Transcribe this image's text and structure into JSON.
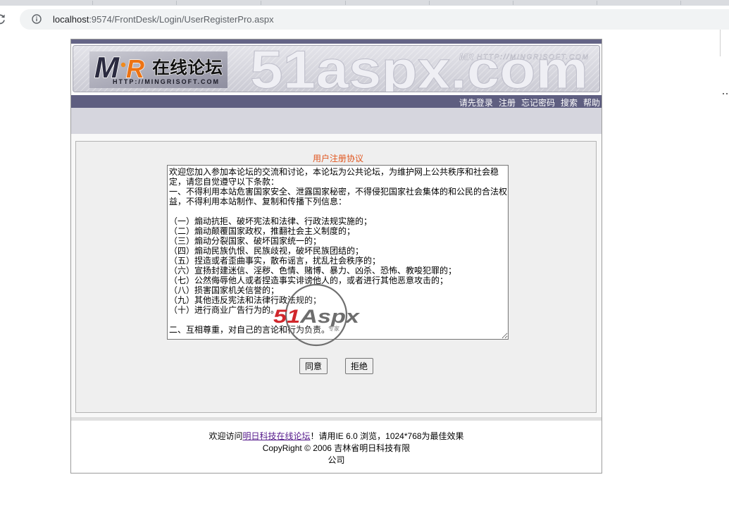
{
  "browser": {
    "url_host": "localhost",
    "url_rest": ":9574/FrontDesk/Login/UserRegisterPro.aspx",
    "icons": {
      "reload": "reload-icon",
      "site_info": "info-icon"
    }
  },
  "banner": {
    "logo_m": "M",
    "logo_r": "R",
    "logo_name": "在线论坛",
    "logo_url": "HTTP://MINGRISOFT.COM",
    "watermark_text": "51aspx.com",
    "corner_mark": "MR",
    "corner_url": "HTTP://MINGRISOFT.COM"
  },
  "nav": {
    "items": [
      {
        "label": "请先登录"
      },
      {
        "label": "注册"
      },
      {
        "label": "忘记密码"
      },
      {
        "label": "搜索"
      },
      {
        "label": "帮助"
      }
    ]
  },
  "agreement": {
    "title": "用户注册协议",
    "text": "欢迎您加入参加本论坛的交流和讨论，本论坛为公共论坛，为维护网上公共秩序和社会稳定，请您自觉遵守以下条款：\n一、不得利用本站危害国家安全、泄露国家秘密，不得侵犯国家社会集体的和公民的合法权益，不得利用本站制作、复制和传播下列信息：\n\n（一）煽动抗拒、破坏宪法和法律、行政法规实施的；\n（二）煽动颠覆国家政权，推翻社会主义制度的；\n（三）煽动分裂国家、破坏国家统一的；\n（四）煽动民族仇恨、民族歧视，破坏民族团结的；\n（五）捏造或者歪曲事实，散布谣言，扰乱社会秩序的；\n（六）宣扬封建迷信、淫秽、色情、赌博、暴力、凶杀、恐怖、教唆犯罪的；\n（七）公然侮辱他人或者捏造事实诽谤他人的，或者进行其他恶意攻击的；\n（八）损害国家机关信誉的；\n（九）其他违反宪法和法律行政法规的；\n（十）进行商业广告行为的。\n\n二、互相尊重，对自己的言论和行为负责。",
    "agree_label": "同意",
    "decline_label": "拒绝"
  },
  "footer": {
    "welcome_prefix": "欢迎访问",
    "site_link": "明日科技在线论坛",
    "welcome_suffix": "！请用IE 6.0 浏览，1024*768为最佳效果",
    "copyright_line1": "CopyRight © 2006 吉林省明日科技有限",
    "copyright_line2": "公司"
  },
  "overlay_watermark": {
    "brand_red": "51",
    "brand_gray": "Aspx",
    "sub": "专家"
  },
  "colors": {
    "nav_bar": "#5e5e80",
    "band": "#d6d6de",
    "title": "#e0561f",
    "footer_link": "#551a8b",
    "logo_accent": "#ec7314"
  }
}
